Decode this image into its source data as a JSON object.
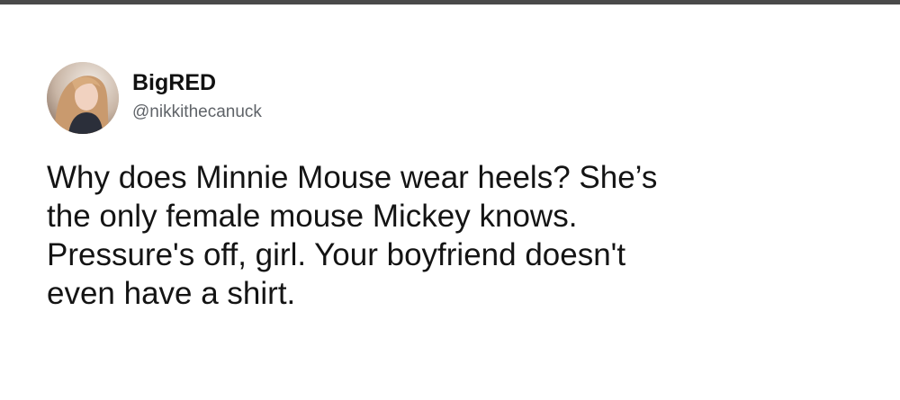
{
  "tweet": {
    "author": {
      "display_name": "BigRED",
      "handle": "@nikkithecanuck",
      "avatar_icon": "profile-photo"
    },
    "text_lines": [
      "Why does Minnie Mouse wear heels? She’s",
      "the only female mouse Mickey knows.",
      "Pressure's off, girl. Your boyfriend doesn't",
      "even have a shirt."
    ]
  },
  "colors": {
    "text": "#141414",
    "handle": "#5f6368",
    "background": "#ffffff",
    "top_border": "#4a4a4a"
  }
}
